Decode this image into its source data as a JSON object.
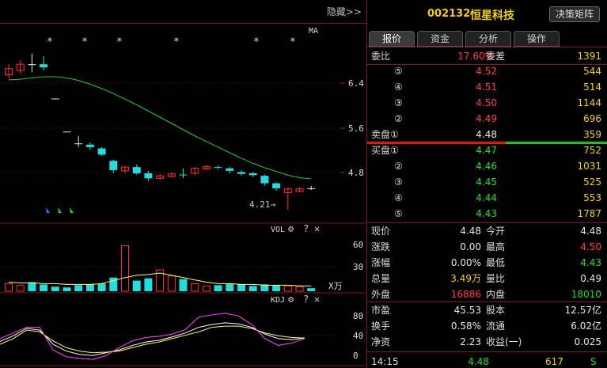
{
  "toolbar": {
    "hide_label": "隐藏>>"
  },
  "kline": {
    "ma_label": "MA",
    "star_label": "*",
    "low_annotation": "4.21→",
    "y_ticks": [
      "6.4",
      "5.6",
      "4.8"
    ]
  },
  "vol_panel": {
    "label": "VOL",
    "y_ticks": [
      "60",
      "30"
    ],
    "unit": "X万",
    "gear": "⚙",
    "help": "?",
    "close": "✕"
  },
  "kdj_panel": {
    "label": "KDJ",
    "y_ticks": [
      "80",
      "40",
      "0"
    ],
    "gear": "⚙",
    "help": "?",
    "close": "✕"
  },
  "header": {
    "code": "002132",
    "name": "恒星科技",
    "decision_btn": "决策矩阵"
  },
  "tabs": [
    "报价",
    "资金",
    "分析",
    "操作"
  ],
  "ratio": {
    "label1": "委比",
    "value1": "17.60%",
    "label2": "委差",
    "value2": "1391"
  },
  "asks": [
    {
      "level": "⑤",
      "price": "4.52",
      "vol": "544"
    },
    {
      "level": "④",
      "price": "4.51",
      "vol": "514"
    },
    {
      "level": "③",
      "price": "4.50",
      "vol": "1144"
    },
    {
      "level": "②",
      "price": "4.49",
      "vol": "696"
    },
    {
      "level": "①",
      "label": "卖盘",
      "price": "4.48",
      "vol": "359"
    }
  ],
  "bids": [
    {
      "level": "①",
      "label": "买盘",
      "price": "4.47",
      "vol": "752"
    },
    {
      "level": "②",
      "price": "4.46",
      "vol": "1031"
    },
    {
      "level": "③",
      "price": "4.45",
      "vol": "525"
    },
    {
      "level": "④",
      "price": "4.44",
      "vol": "553"
    },
    {
      "level": "⑤",
      "price": "4.43",
      "vol": "1787"
    }
  ],
  "quote": [
    {
      "l1": "现价",
      "v1": "4.48",
      "l2": "今开",
      "v2": "4.48"
    },
    {
      "l1": "涨跌",
      "v1": "0.00",
      "l2": "最高",
      "v2": "4.50"
    },
    {
      "l1": "涨幅",
      "v1": "0.00%",
      "l2": "最低",
      "v2": "4.43"
    },
    {
      "l1": "总量",
      "v1": "3.49万",
      "l2": "量比",
      "v2": "0.49"
    },
    {
      "l1": "外盘",
      "v1": "16886",
      "l2": "内盘",
      "v2": "18010"
    },
    {
      "l1": "市盈",
      "v1": "45.53",
      "l2": "股本",
      "v2": "12.57亿"
    },
    {
      "l1": "换手",
      "v1": "0.58%",
      "l2": "流通",
      "v2": "6.02亿"
    },
    {
      "l1": "净资",
      "v1": "2.23",
      "l2": "收益(一)",
      "v2": "0.025"
    }
  ],
  "last_trade": {
    "time": "14:15",
    "price": "4.48",
    "vol": "617",
    "side": "S"
  },
  "chart_data": {
    "type": "candlestick",
    "candles": [
      {
        "open": 6.38,
        "close": 6.48,
        "high": 6.55,
        "low": 6.33
      },
      {
        "open": 6.45,
        "close": 6.55,
        "high": 6.61,
        "low": 6.4
      },
      {
        "open": 6.55,
        "close": 6.55,
        "high": 6.72,
        "low": 6.42
      },
      {
        "open": 6.55,
        "close": 6.5,
        "high": 6.68,
        "low": 6.45
      },
      {
        "open": 6.0,
        "close": 6.0,
        "high": 6.0,
        "low": 6.0
      },
      {
        "open": 5.47,
        "close": 5.47,
        "high": 5.47,
        "low": 5.47
      },
      {
        "open": 5.28,
        "close": 5.28,
        "high": 5.4,
        "low": 5.22
      },
      {
        "open": 5.26,
        "close": 5.22,
        "high": 5.3,
        "low": 5.18
      },
      {
        "open": 5.2,
        "close": 5.1,
        "high": 5.22,
        "low": 5.08
      },
      {
        "open": 5.0,
        "close": 4.85,
        "high": 5.02,
        "low": 4.8
      },
      {
        "open": 4.84,
        "close": 4.9,
        "high": 4.92,
        "low": 4.8
      },
      {
        "open": 4.9,
        "close": 4.8,
        "high": 4.94,
        "low": 4.78
      },
      {
        "open": 4.8,
        "close": 4.72,
        "high": 4.84,
        "low": 4.68
      },
      {
        "open": 4.72,
        "close": 4.76,
        "high": 4.79,
        "low": 4.7
      },
      {
        "open": 4.75,
        "close": 4.79,
        "high": 4.81,
        "low": 4.73
      },
      {
        "open": 4.78,
        "close": 4.77,
        "high": 4.88,
        "low": 4.72
      },
      {
        "open": 4.8,
        "close": 4.88,
        "high": 4.9,
        "low": 4.77
      },
      {
        "open": 4.87,
        "close": 4.91,
        "high": 4.93,
        "low": 4.85
      },
      {
        "open": 4.9,
        "close": 4.89,
        "high": 4.93,
        "low": 4.87
      },
      {
        "open": 4.88,
        "close": 4.84,
        "high": 4.9,
        "low": 4.8
      },
      {
        "open": 4.82,
        "close": 4.79,
        "high": 4.85,
        "low": 4.76
      },
      {
        "open": 4.8,
        "close": 4.77,
        "high": 4.82,
        "low": 4.74
      },
      {
        "open": 4.76,
        "close": 4.64,
        "high": 4.78,
        "low": 4.6
      },
      {
        "open": 4.64,
        "close": 4.56,
        "high": 4.66,
        "low": 4.52
      },
      {
        "open": 4.49,
        "close": 4.55,
        "high": 4.57,
        "low": 4.21
      },
      {
        "open": 4.51,
        "close": 4.55,
        "high": 4.58,
        "low": 4.5
      },
      {
        "open": 4.56,
        "close": 4.56,
        "high": 4.6,
        "low": 4.53
      }
    ],
    "ma": [
      6.3,
      6.31,
      6.33,
      6.35,
      6.35,
      6.33,
      6.29,
      6.23,
      6.16,
      6.08,
      5.99,
      5.9,
      5.8,
      5.7,
      5.6,
      5.5,
      5.4,
      5.31,
      5.22,
      5.13,
      5.04,
      4.96,
      4.89,
      4.83,
      4.77,
      4.73,
      4.71
    ],
    "ylim": [
      4.0,
      7.2
    ],
    "volume": [
      10,
      8,
      12,
      9,
      6,
      5,
      8,
      9,
      10,
      18,
      60,
      14,
      17,
      28,
      20,
      16,
      10,
      7,
      8,
      10,
      9,
      7,
      9,
      8,
      7,
      6,
      4
    ],
    "vol_ma": [
      12,
      11,
      11,
      10,
      10,
      9,
      9,
      9,
      10,
      14,
      18,
      21,
      22,
      24,
      21,
      18,
      15,
      12,
      10,
      10,
      9,
      9,
      8,
      8,
      8,
      7,
      7
    ],
    "vol_ylim": [
      0,
      75
    ],
    "kdj": {
      "k": [
        35,
        45,
        58,
        55,
        30,
        18,
        12,
        10,
        15,
        20,
        28,
        34,
        37,
        43,
        50,
        60,
        65,
        68,
        66,
        60,
        48,
        40,
        38,
        41
      ],
      "d": [
        30,
        40,
        55,
        52,
        36,
        24,
        18,
        15,
        16,
        18,
        24,
        30,
        34,
        40,
        46,
        52,
        60,
        62,
        62,
        58,
        50,
        45,
        42,
        41
      ],
      "j": [
        40,
        50,
        60,
        60,
        20,
        8,
        5,
        3,
        10,
        24,
        36,
        42,
        44,
        48,
        56,
        78,
        82,
        85,
        80,
        65,
        40,
        28,
        32,
        40
      ]
    },
    "kdj_ylim": [
      -5,
      100
    ]
  }
}
